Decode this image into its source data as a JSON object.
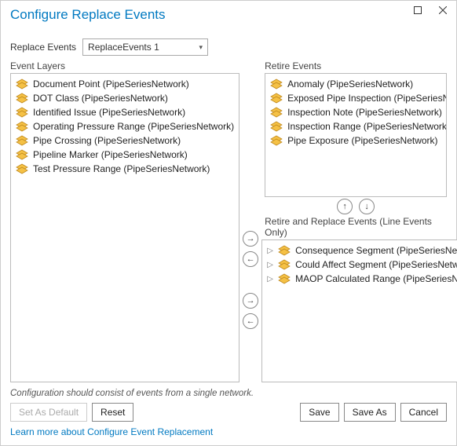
{
  "window": {
    "title": "Configure Replace Events"
  },
  "header": {
    "label": "Replace Events",
    "selected": "ReplaceEvents 1"
  },
  "panels": {
    "event_layers_label": "Event Layers",
    "retire_events_label": "Retire Events",
    "retire_replace_label": "Retire and Replace Events (Line Events Only)"
  },
  "event_layers": [
    {
      "label": "Document Point (PipeSeriesNetwork)"
    },
    {
      "label": "DOT Class (PipeSeriesNetwork)"
    },
    {
      "label": "Identified Issue (PipeSeriesNetwork)"
    },
    {
      "label": "Operating Pressure Range (PipeSeriesNetwork)"
    },
    {
      "label": "Pipe Crossing (PipeSeriesNetwork)"
    },
    {
      "label": "Pipeline Marker (PipeSeriesNetwork)"
    },
    {
      "label": "Test Pressure Range (PipeSeriesNetwork)"
    }
  ],
  "retire_events": [
    {
      "label": "Anomaly (PipeSeriesNetwork)"
    },
    {
      "label": "Exposed Pipe Inspection (PipeSeriesNetwork)"
    },
    {
      "label": "Inspection Note (PipeSeriesNetwork)"
    },
    {
      "label": "Inspection Range (PipeSeriesNetwork)"
    },
    {
      "label": "Pipe Exposure (PipeSeriesNetwork)"
    }
  ],
  "retire_replace_events": [
    {
      "label": "Consequence Segment (PipeSeriesNetwork)"
    },
    {
      "label": "Could Affect Segment (PipeSeriesNetwork)"
    },
    {
      "label": "MAOP Calculated Range (PipeSeriesNetwork)"
    }
  ],
  "hint": "Configuration should consist of events from a single network.",
  "buttons": {
    "set_default": "Set As Default",
    "reset": "Reset",
    "save": "Save",
    "save_as": "Save As",
    "cancel": "Cancel"
  },
  "link": "Learn more about Configure Event Replacement",
  "arrows": {
    "right": "→",
    "left": "←",
    "up": "↑",
    "down": "↓"
  }
}
